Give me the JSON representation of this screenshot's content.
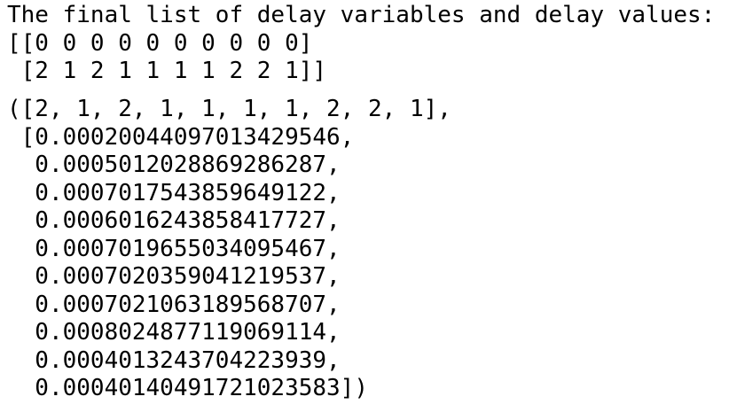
{
  "stdout": {
    "lines": [
      "The final list of delay variables and delay values:",
      "[[0 0 0 0 0 0 0 0 0 0]",
      " [2 1 2 1 1 1 1 2 2 1]]"
    ]
  },
  "result": {
    "lines": [
      "([2, 1, 2, 1, 1, 1, 1, 2, 2, 1],",
      " [0.00020044097013429546,",
      "  0.0005012028869286287,",
      "  0.0007017543859649122,",
      "  0.0006016243858417727,",
      "  0.0007019655034095467,",
      "  0.0007020359041219537,",
      "  0.0007021063189568707,",
      "  0.0008024877119069114,",
      "  0.0004013243704223939,",
      "  0.00040140491721023583])"
    ]
  }
}
